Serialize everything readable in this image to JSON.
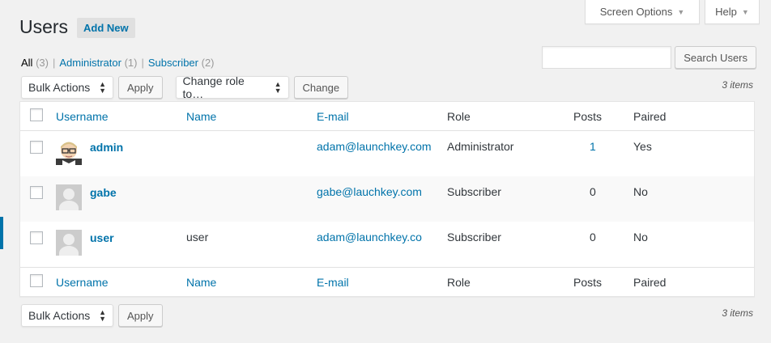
{
  "screen_meta": {
    "screen_options_label": "Screen Options",
    "help_label": "Help"
  },
  "page": {
    "title": "Users",
    "add_new_label": "Add New"
  },
  "views": [
    {
      "label": "All",
      "count": "(3)"
    },
    {
      "label": "Administrator",
      "count": "(1)"
    },
    {
      "label": "Subscriber",
      "count": "(2)"
    }
  ],
  "view_separator": "|",
  "search": {
    "value": "",
    "button_label": "Search Users"
  },
  "tablenav_top": {
    "bulk_actions_label": "Bulk Actions",
    "apply_label": "Apply",
    "change_role_label": "Change role to…",
    "change_label": "Change",
    "items_count": "3 items"
  },
  "tablenav_bottom": {
    "bulk_actions_label": "Bulk Actions",
    "apply_label": "Apply",
    "items_count": "3 items"
  },
  "columns": {
    "username": "Username",
    "name": "Name",
    "email": "E-mail",
    "role": "Role",
    "posts": "Posts",
    "paired": "Paired"
  },
  "users": [
    {
      "username": "admin",
      "name": "",
      "email": "adam@launchkey.com",
      "role": "Administrator",
      "posts": "1",
      "paired": "Yes",
      "avatar": "custom-avatar-icon"
    },
    {
      "username": "gabe",
      "name": "",
      "email": "gabe@lauchkey.com",
      "role": "Subscriber",
      "posts": "0",
      "paired": "No",
      "avatar": "default-avatar-icon"
    },
    {
      "username": "user",
      "name": "user",
      "email": "adam@launchkey.co",
      "role": "Subscriber",
      "posts": "0",
      "paired": "No",
      "avatar": "default-avatar-icon"
    }
  ],
  "colors": {
    "link": "#0073aa",
    "background": "#f1f1f1",
    "text": "#32373c"
  }
}
